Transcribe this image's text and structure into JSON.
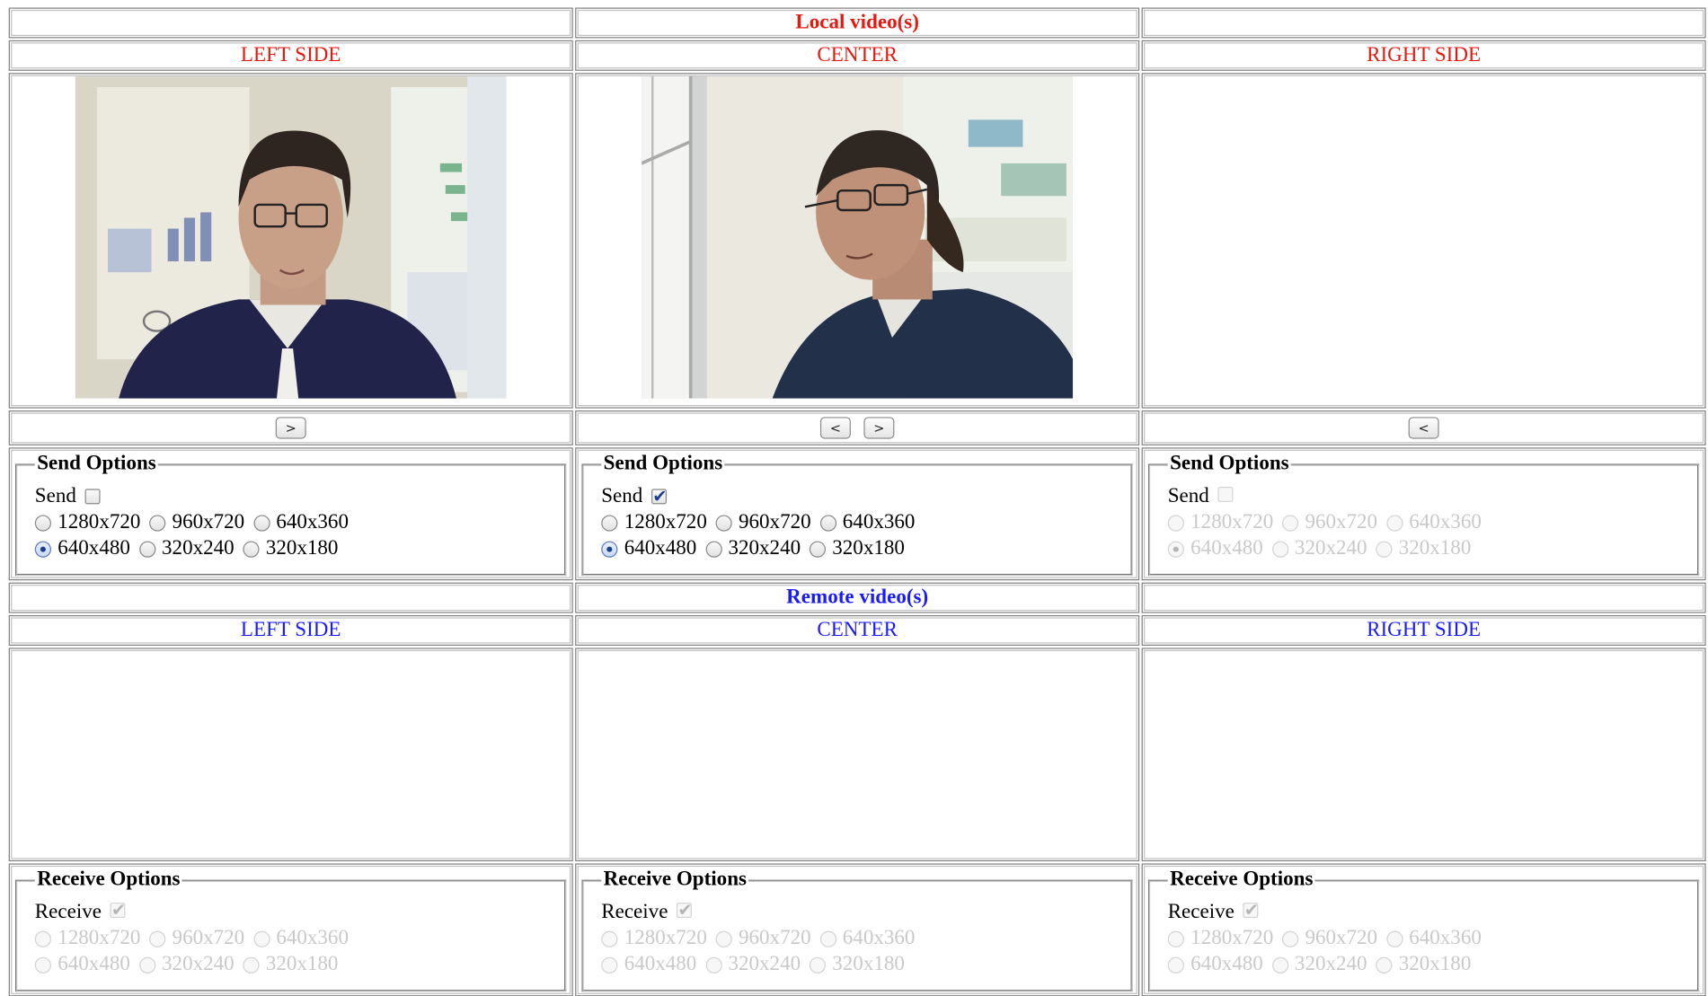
{
  "local": {
    "title": "Local video(s)",
    "sides": [
      "LEFT SIDE",
      "CENTER",
      "RIGHT SIDE"
    ],
    "send_legend": "Send Options",
    "send_label": "Send",
    "send_checked": [
      false,
      true,
      false
    ],
    "resolutions_row1": [
      "1280x720",
      "960x720",
      "640x360"
    ],
    "resolutions_row2": [
      "640x480",
      "320x240",
      "320x180"
    ],
    "selected_resolution": "640x480",
    "nav_left": "<",
    "nav_right": ">"
  },
  "remote": {
    "title": "Remote video(s)",
    "sides": [
      "LEFT SIDE",
      "CENTER",
      "RIGHT SIDE"
    ],
    "receive_legend": "Receive Options",
    "receive_label": "Receive",
    "receive_checked": [
      true,
      true,
      true
    ],
    "resolutions_row1": [
      "1280x720",
      "960x720",
      "640x360"
    ],
    "resolutions_row2": [
      "640x480",
      "320x240",
      "320x180"
    ]
  },
  "colors": {
    "local_text": "#e8180f",
    "remote_text": "#1a1aff"
  }
}
